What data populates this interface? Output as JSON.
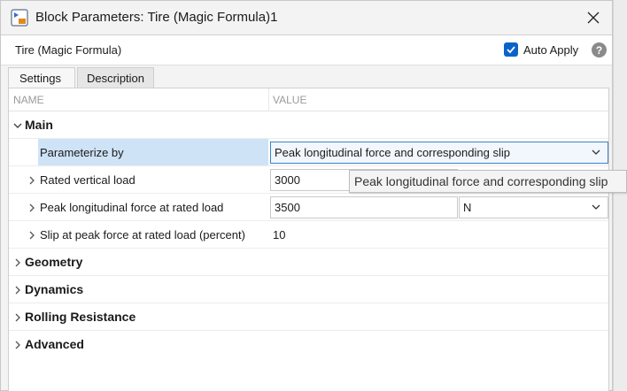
{
  "window": {
    "title": "Block Parameters: Tire (Magic Formula)1",
    "block_name": "Tire (Magic Formula)",
    "auto_apply_label": "Auto Apply",
    "auto_apply_checked": true,
    "help_glyph": "?"
  },
  "tabs": [
    {
      "label": "Settings",
      "active": true
    },
    {
      "label": "Description",
      "active": false
    }
  ],
  "columns": {
    "name": "NAME",
    "value": "VALUE"
  },
  "groups": {
    "main": "Main",
    "geometry": "Geometry",
    "dynamics": "Dynamics",
    "rolling_resistance": "Rolling Resistance",
    "advanced": "Advanced"
  },
  "params": {
    "parameterize_by": {
      "label": "Parameterize by",
      "value": "Peak longitudinal force and corresponding slip"
    },
    "rated_vertical_load": {
      "label": "Rated vertical load",
      "value": "3000"
    },
    "peak_force": {
      "label": "Peak longitudinal force at rated load",
      "value": "3500",
      "unit": "N"
    },
    "slip_at_peak": {
      "label": "Slip at peak force at rated load (percent)",
      "value": "10"
    }
  },
  "tooltip": "Peak longitudinal force and corresponding slip",
  "colors": {
    "accent": "#0b63c9",
    "selection": "#cfe3f7"
  },
  "icons": [
    "app-icon",
    "close-icon",
    "checkbox-check-icon",
    "help-icon",
    "chevron-down-icon",
    "chevron-right-icon"
  ]
}
